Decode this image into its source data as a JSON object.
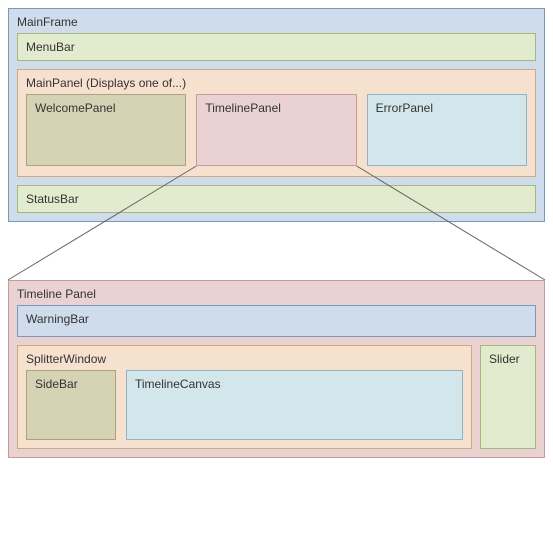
{
  "mainframe": {
    "title": "MainFrame",
    "menubar": {
      "label": "MenuBar"
    },
    "mainpanel": {
      "label": "MainPanel  (Displays one of...)",
      "panels": {
        "welcome": "WelcomePanel",
        "timeline": "TimelinePanel",
        "error": "ErrorPanel"
      }
    },
    "statusbar": {
      "label": "StatusBar"
    }
  },
  "timelinepanel": {
    "title": "Timeline Panel",
    "warningbar": {
      "label": "WarningBar"
    },
    "splitterwindow": {
      "label": "SplitterWindow",
      "sidebar": "SideBar",
      "timelinecanvas": "TimelineCanvas"
    },
    "slider": {
      "label": "Slider"
    }
  }
}
